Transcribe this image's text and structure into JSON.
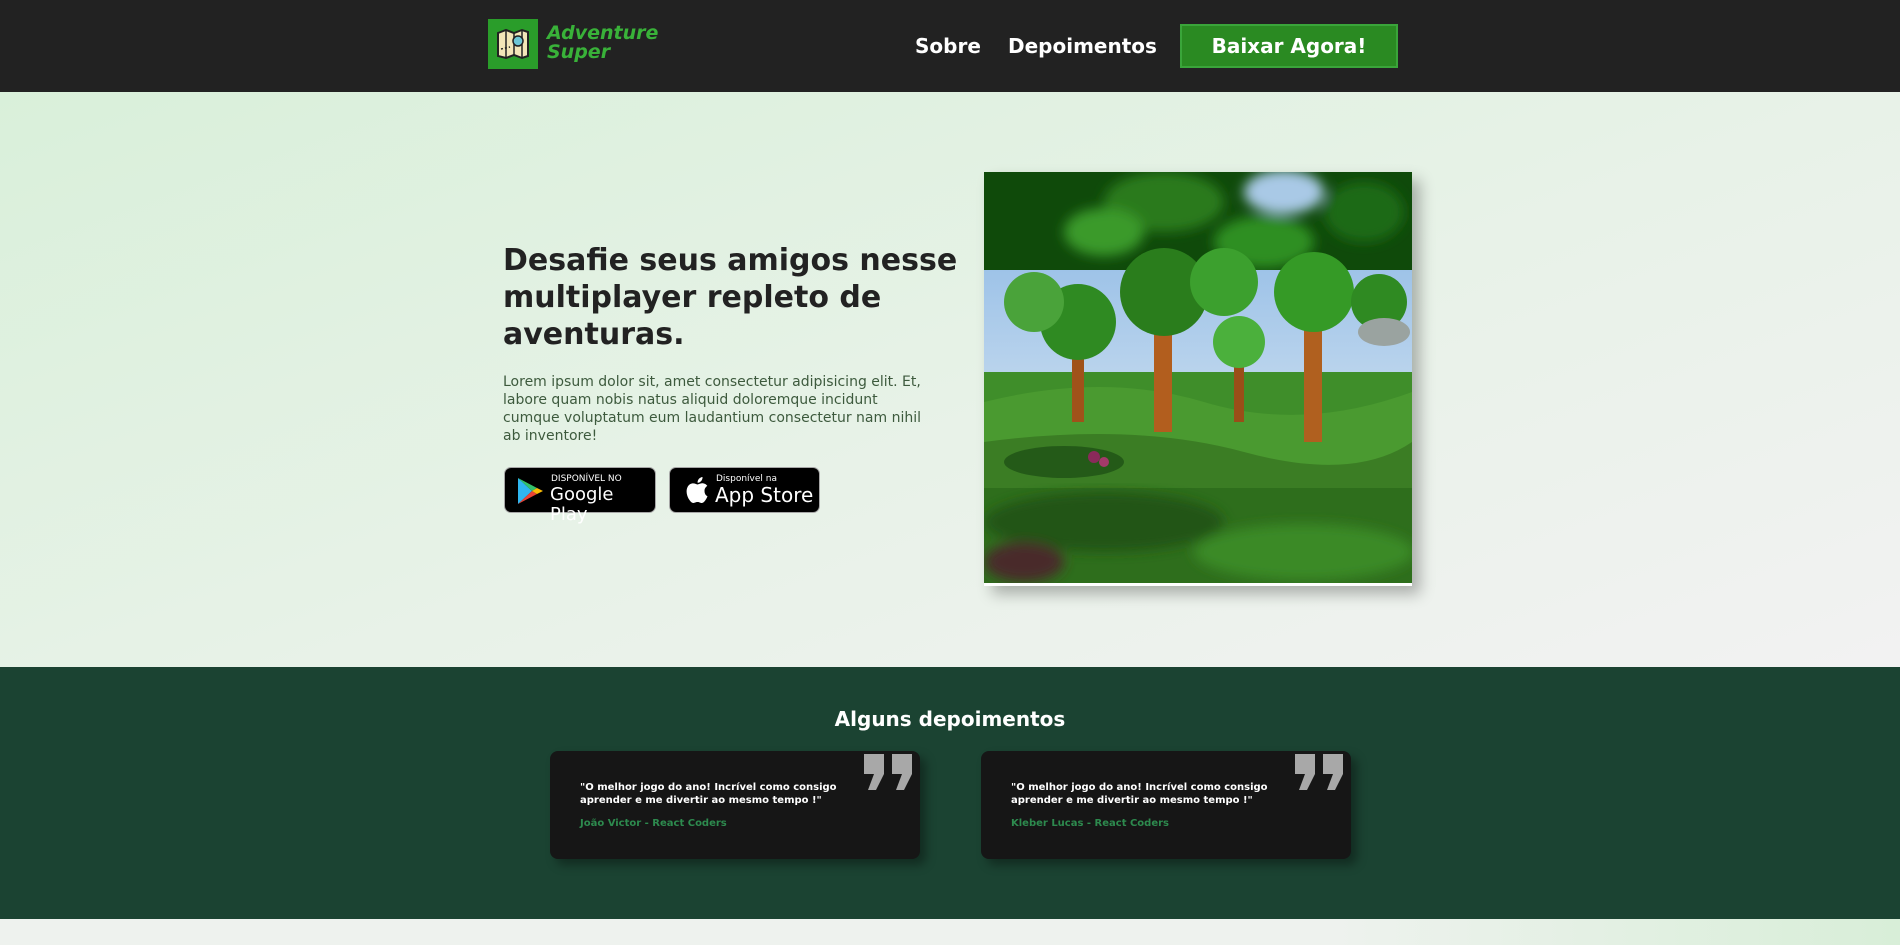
{
  "header": {
    "logo_line1": "Adventure",
    "logo_line2": "Super",
    "nav": {
      "sobre": "Sobre",
      "depoimentos": "Depoimentos"
    },
    "cta_label": "Baixar Agora!"
  },
  "hero": {
    "title": "Desafie seus amigos nesse multiplayer repleto de aventuras.",
    "description": "Lorem ipsum dolor sit, amet consectetur adipisicing elit. Et, labore quam nobis natus aliquid doloremque incidunt cumque voluptatum eum laudantium consectetur nam nihil ab inventore!",
    "google_badge": {
      "small": "DISPONÍVEL NO",
      "big": "Google Play"
    },
    "apple_badge": {
      "small": "Disponível na",
      "big": "App Store"
    }
  },
  "testimonials": {
    "title": "Alguns depoimentos",
    "items": [
      {
        "quote": "\"O melhor jogo do ano! Incrível como consigo aprender e me divertir ao mesmo tempo !\"",
        "author": "João Victor - React Coders"
      },
      {
        "quote": "\"O melhor jogo do ano! Incrível como consigo aprender e me divertir ao mesmo tempo !\"",
        "author": "Kleber Lucas - React Coders"
      }
    ]
  },
  "icons": {
    "logo": "treasure-map-icon",
    "google": "google-play-icon",
    "apple": "apple-icon",
    "quote": "quote-icon"
  },
  "colors": {
    "header_bg": "#222222",
    "brand_green": "#39b239",
    "cta_bg": "#2a8a22",
    "testimonials_bg": "#1b4332",
    "card_bg": "#161616",
    "author_color": "#2d8a4e"
  }
}
